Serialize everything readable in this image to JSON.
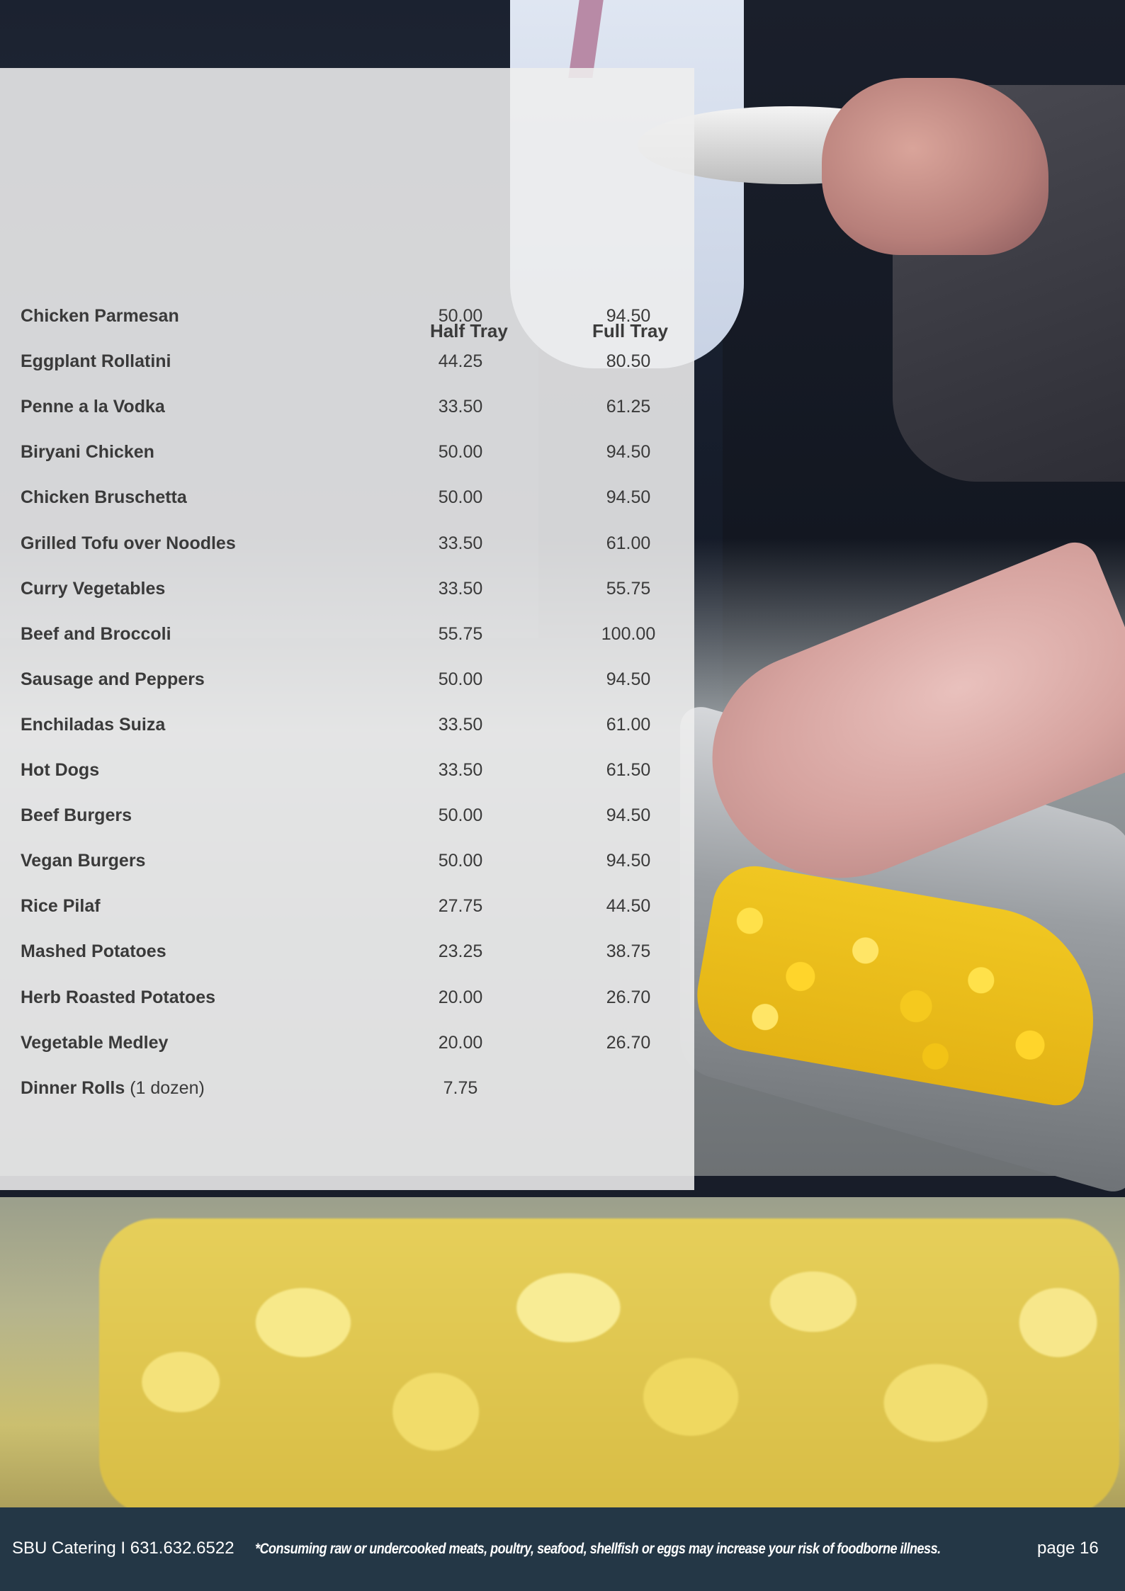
{
  "header": {
    "half_tray": "Half Tray",
    "full_tray": "Full Tray"
  },
  "menu": {
    "items": [
      {
        "name": "Chicken Parmesan",
        "note": "",
        "half": "50.00",
        "full": "94.50"
      },
      {
        "name": "Eggplant Rollatini",
        "note": "",
        "half": "44.25",
        "full": "80.50"
      },
      {
        "name": "Penne a la Vodka",
        "note": "",
        "half": "33.50",
        "full": "61.25"
      },
      {
        "name": "Biryani Chicken",
        "note": "",
        "half": "50.00",
        "full": "94.50"
      },
      {
        "name": "Chicken Bruschetta",
        "note": "",
        "half": "50.00",
        "full": "94.50"
      },
      {
        "name": "Grilled Tofu over Noodles",
        "note": "",
        "half": "33.50",
        "full": "61.00"
      },
      {
        "name": "Curry Vegetables",
        "note": "",
        "half": "33.50",
        "full": "55.75"
      },
      {
        "name": "Beef and Broccoli",
        "note": "",
        "half": "55.75",
        "full": "100.00"
      },
      {
        "name": "Sausage and Peppers",
        "note": "",
        "half": "50.00",
        "full": "94.50"
      },
      {
        "name": "Enchiladas Suiza",
        "note": "",
        "half": "33.50",
        "full": "61.00"
      },
      {
        "name": "Hot Dogs",
        "note": "",
        "half": "33.50",
        "full": "61.50"
      },
      {
        "name": "Beef Burgers",
        "note": "",
        "half": "50.00",
        "full": "94.50"
      },
      {
        "name": "Vegan Burgers",
        "note": "",
        "half": "50.00",
        "full": "94.50"
      },
      {
        "name": "Rice Pilaf",
        "note": "",
        "half": "27.75",
        "full": "44.50"
      },
      {
        "name": "Mashed Potatoes",
        "note": "",
        "half": "23.25",
        "full": "38.75"
      },
      {
        "name": "Herb Roasted Potatoes",
        "note": "",
        "half": "20.00",
        "full": "26.70"
      },
      {
        "name": "Vegetable Medley",
        "note": "",
        "half": "20.00",
        "full": "26.70"
      },
      {
        "name": "Dinner Rolls",
        "note": "(1 dozen)",
        "half": "7.75",
        "full": ""
      }
    ]
  },
  "footer": {
    "contact": "SBU Catering I 631.632.6522",
    "warning": "*Consuming raw or undercooked meats, poultry, seafood, shellfish or eggs may increase your risk of foodborne illness.",
    "page": "page 16"
  }
}
